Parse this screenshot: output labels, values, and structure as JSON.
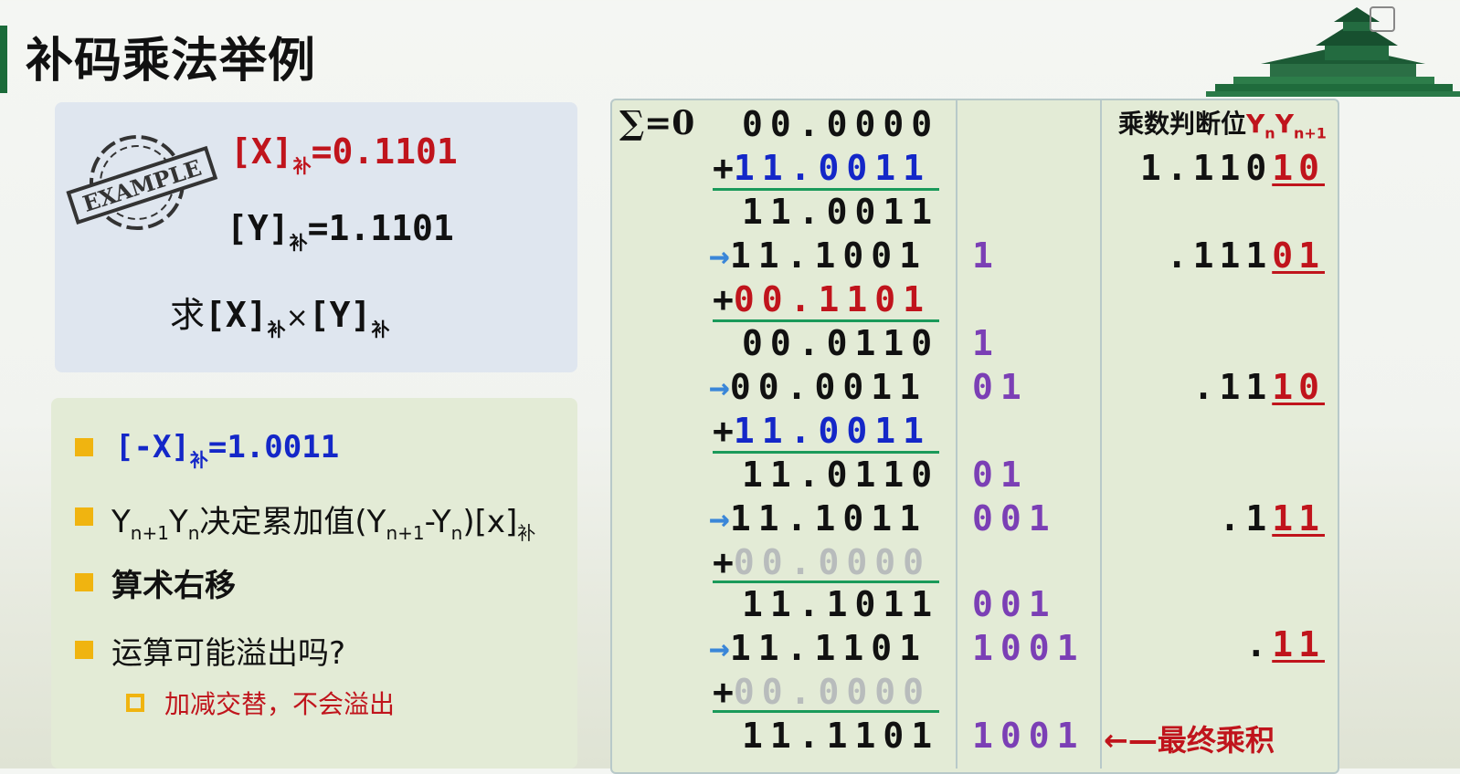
{
  "title": "补码乘法举例",
  "example": {
    "stamp_text": "EXAMPLE",
    "x_lhs": "[X]",
    "x_sub": "补",
    "x_rhs": "=0.1101",
    "y_lhs": "[Y]",
    "y_sub": "补",
    "y_rhs": "=1.1101",
    "ask_prefix": "求",
    "ask_x": "[X]",
    "ask_x_sub": "补",
    "ask_times": "×",
    "ask_y": "[Y]",
    "ask_y_sub": "补"
  },
  "notes": {
    "n1_lhs": "[-X]",
    "n1_sub": "补",
    "n1_rhs": "=1.0011",
    "n2_a": "Y",
    "n2_a_sub": "n+1",
    "n2_b": "Y",
    "n2_b_sub": "n",
    "n2_text": "决定累加值(Y",
    "n2_c_sub": "n+1",
    "n2_mid": "-Y",
    "n2_d_sub": "n",
    "n2_end": ")[x]",
    "n2_end_sub": "补",
    "n3": "算术右移",
    "n4": "运算可能溢出吗?",
    "n4_sub": "加减交替，不会溢出"
  },
  "calc": {
    "sigma": "∑=0",
    "header_text": "乘数判断位",
    "header_y1": "Y",
    "header_y1_sub": "n",
    "header_y2": "Y",
    "header_y2_sub": "n+1",
    "rows": [
      "00.0000",
      "11.0011",
      "11.0011",
      "11.1001",
      "00.1101",
      "00.0110",
      "00.0011",
      "11.0011",
      "11.0110",
      "11.1011",
      "00.0000",
      "11.1011",
      "11.1101",
      "00.0000",
      "11.1101"
    ],
    "plus": "+",
    "arrow": "→",
    "shifted": [
      "1",
      "1",
      "01",
      "01",
      "001",
      "001",
      "1001",
      "1001"
    ],
    "judge": [
      {
        "pre": "1.110",
        "u": "10"
      },
      {
        "pre": ".111",
        "u": "01"
      },
      {
        "pre": ".11",
        "u": "10"
      },
      {
        "pre": ".1",
        "u": "11"
      },
      {
        "pre": ".",
        "u": "11"
      }
    ],
    "final_label": "←—最终乘积"
  }
}
